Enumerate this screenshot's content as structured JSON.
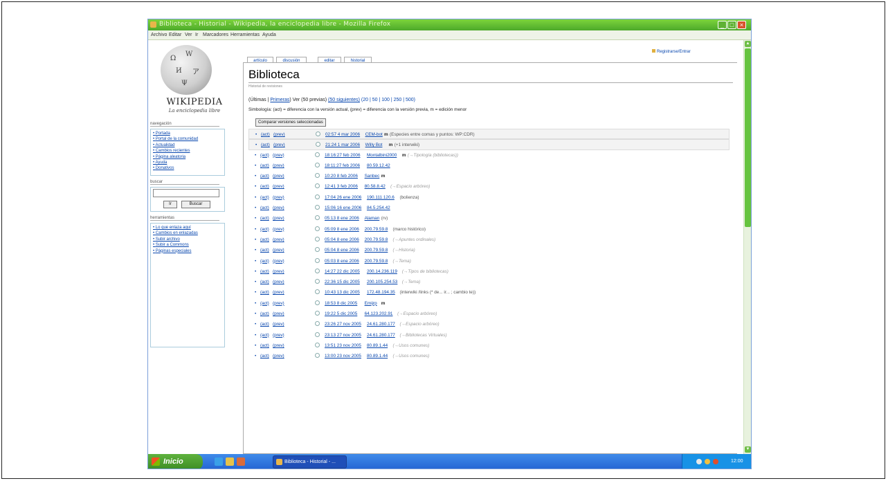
{
  "window": {
    "title": "Biblioteca - Historial - Wikipedia, la enciclopedia libre - Mozilla Firefox"
  },
  "menubar": [
    "Archivo",
    "Editar",
    "Ver",
    "Ir",
    "Marcadores",
    "Herramientas",
    "Ayuda"
  ],
  "logo": {
    "wordmark": "WIKIPEDIA",
    "tagline": "La enciclopedia libre"
  },
  "sidebar": {
    "nav_heading": "navegación",
    "nav_items": [
      "Portada",
      "Portal de la comunidad",
      "Actualidad",
      "Cambios recientes",
      "Página aleatoria",
      "Ayuda",
      "Donativos"
    ],
    "search_heading": "buscar",
    "search_go": "Ir",
    "search_button": "Buscar",
    "tools_heading": "herramientas",
    "tools_items": [
      "Lo que enlaza aquí",
      "Cambios en enlazadas",
      "Subir archivo",
      "Subir a Commons",
      "Páginas especiales"
    ]
  },
  "tabs": [
    "artículo",
    "discusión",
    "editar",
    "historial"
  ],
  "user_link": "Registrarse/Entrar",
  "page": {
    "title": "Biblioteca",
    "subtitle": "Historial de revisiones",
    "nav_prefix": "(Últimas | ",
    "nav_first": "Primeras",
    "nav_mid": ") Ver (50 previas) ",
    "nav_next": "(50 siguientes)",
    "nav_sizes": " (20 | 50 | 100 | 250 | 500)",
    "legend": "Simbología: (act) = diferencia con la versión actual, (prev) = diferencia con la versión previa, m = edición menor",
    "compare_button": "Comparar versiones seleccionadas"
  },
  "history": [
    {
      "cur": "(act)",
      "prev": "(prev)",
      "date": "02:57 4 mar 2006",
      "user": "CEM-bot",
      "minor": "m",
      "comment": "(Especies entre comas y puntos: WP:CDR)",
      "gray": false
    },
    {
      "cur": "(act)",
      "prev": "(prev)",
      "date": "21:24 1 mar 2006",
      "user": "Willy Bot",
      "minor": "m",
      "comment": "(+1 interwiki)",
      "gray": false
    },
    {
      "cur": "(act)",
      "prev": "(prev)",
      "date": "18:16:27 feb 2006",
      "user": "Montalbini2000",
      "minor": "m",
      "comment": "(→Tipología (bibliotecas))",
      "gray": true
    },
    {
      "cur": "(act)",
      "prev": "(prev)",
      "date": "18:11:27 feb 2006",
      "user": "80.59.12.42",
      "minor": "",
      "comment": "",
      "gray": false
    },
    {
      "cur": "(act)",
      "prev": "(prev)",
      "date": "10:20 8 feb 2006",
      "user": "Sanbec",
      "minor": "m",
      "comment": "",
      "gray": false
    },
    {
      "cur": "(act)",
      "prev": "(prev)",
      "date": "12:41 3 feb 2006",
      "user": "80.58.8.42",
      "minor": "",
      "comment": "(→Espacio arbóreo)",
      "gray": true
    },
    {
      "cur": "(act)",
      "prev": "(prev)",
      "date": "17:04 26 ene 2006",
      "user": "190.111.120.6",
      "minor": "",
      "comment": "(bolienza)",
      "gray": false
    },
    {
      "cur": "(act)",
      "prev": "(prev)",
      "date": "15:06 16 ene 2006",
      "user": "84.5.254.42",
      "minor": "",
      "comment": "",
      "gray": false
    },
    {
      "cur": "(act)",
      "prev": "(prev)",
      "date": "05:13 8 ene 2006",
      "user": "Alaman",
      "minor": "",
      "comment": "(rv)",
      "gray": false
    },
    {
      "cur": "(act)",
      "prev": "(prev)",
      "date": "05:09 8 ene 2006",
      "user": "200.79.59.8",
      "minor": "",
      "comment": "(marco histórico)",
      "gray": false
    },
    {
      "cur": "(act)",
      "prev": "(prev)",
      "date": "05:04 8 ene 2006",
      "user": "200.79.59.8",
      "minor": "",
      "comment": "(→Apuntes ordinales)",
      "gray": true
    },
    {
      "cur": "(act)",
      "prev": "(prev)",
      "date": "05:04 8 ene 2006",
      "user": "200.79.59.8",
      "minor": "",
      "comment": "(→Historia)",
      "gray": true
    },
    {
      "cur": "(act)",
      "prev": "(prev)",
      "date": "05:03 8 ene 2006",
      "user": "200.79.59.8",
      "minor": "",
      "comment": "(→Tema)",
      "gray": true
    },
    {
      "cur": "(act)",
      "prev": "(prev)",
      "date": "14:27 22 dic 2005",
      "user": "200.14.236.119",
      "minor": "",
      "comment": "(→Tipos de bibliotecas)",
      "gray": true
    },
    {
      "cur": "(act)",
      "prev": "(prev)",
      "date": "22:36 15 dic 2005",
      "user": "200.105.254.53",
      "minor": "",
      "comment": "(→Tema)",
      "gray": true
    },
    {
      "cur": "(act)",
      "prev": "(prev)",
      "date": "10:43 13 dic 2005",
      "user": "172.48.194.35",
      "minor": "",
      "comment": "(interwiki /links (* de... ir... ; cambio te))",
      "gray": false
    },
    {
      "cur": "(act)",
      "prev": "(prev)",
      "date": "18:53 8 dic 2005",
      "user": "Emijrp",
      "minor": "m",
      "comment": "",
      "gray": false
    },
    {
      "cur": "(act)",
      "prev": "(prev)",
      "date": "19:22 5 dic 2005",
      "user": "64.123.202.91",
      "minor": "",
      "comment": "(→Espacio arbóreo)",
      "gray": true
    },
    {
      "cur": "(act)",
      "prev": "(prev)",
      "date": "23:26 27 nov 2005",
      "user": "24.61.280.177",
      "minor": "",
      "comment": "(→Espacio arbóreo)",
      "gray": true
    },
    {
      "cur": "(act)",
      "prev": "(prev)",
      "date": "23:13 27 nov 2005",
      "user": "24.61.280.177",
      "minor": "",
      "comment": "(→Bibliotecas Virtuales)",
      "gray": true
    },
    {
      "cur": "(act)",
      "prev": "(prev)",
      "date": "13:51 23 nov 2005",
      "user": "80.89.1.44",
      "minor": "",
      "comment": "(→Usos comunes)",
      "gray": true
    },
    {
      "cur": "(act)",
      "prev": "(prev)",
      "date": "13:00 23 nov 2005",
      "user": "80.89.1.44",
      "minor": "",
      "comment": "(→Usos comunes)",
      "gray": true
    }
  ],
  "taskbar": {
    "start": "Inicio",
    "task": "Biblioteca - Historial - ...",
    "clock": "12:00"
  }
}
